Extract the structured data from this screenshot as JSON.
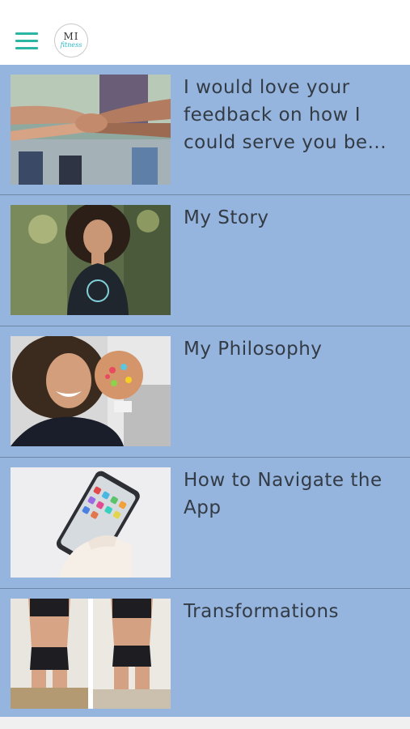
{
  "header": {
    "menu_icon": "hamburger-menu-icon",
    "logo": {
      "line1": "MI",
      "line2": "fitness"
    }
  },
  "items": [
    {
      "title": "I would love your feedback on how I could serve you be...",
      "thumb": "hands-stacked-photo"
    },
    {
      "title": "My Story",
      "thumb": "woman-portrait-photo"
    },
    {
      "title": "My Philosophy",
      "thumb": "woman-with-donut-photo"
    },
    {
      "title": "How to Navigate the App",
      "thumb": "hand-holding-phone-photo"
    },
    {
      "title": "Transformations",
      "thumb": "before-after-photo"
    }
  ],
  "colors": {
    "accent": "#2bb5a5",
    "list_bg": "#95b4de",
    "text": "#333b45"
  }
}
